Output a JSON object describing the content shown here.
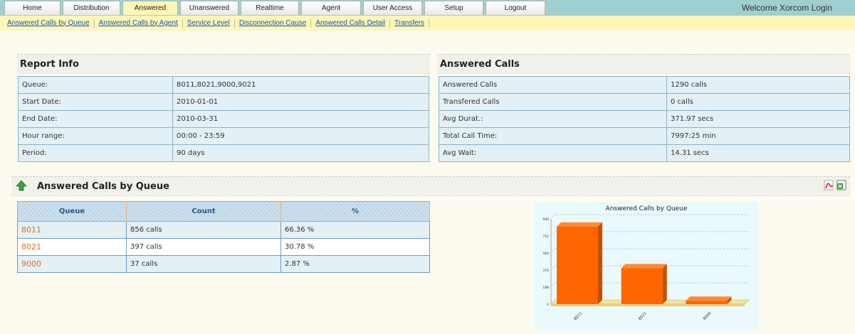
{
  "nav": {
    "tabs": [
      "Home",
      "Distribution",
      "Answered",
      "Unanswered",
      "Realtime",
      "Agent",
      "User Access",
      "Setup",
      "Logout"
    ],
    "active": "Answered",
    "welcome": "Welcome Xorcom Login"
  },
  "subnav": [
    "Answered Calls by Queue",
    "Answered Calls by Agent",
    "Service Level",
    "Disconnection Cause",
    "Answered Calls Detail",
    "Transfers"
  ],
  "report_info": {
    "title": "Report Info",
    "rows": [
      {
        "label": "Queue:",
        "value": "8011,8021,9000,9021"
      },
      {
        "label": "Start Date:",
        "value": "2010-01-01"
      },
      {
        "label": "End Date:",
        "value": "2010-03-31"
      },
      {
        "label": "Hour range:",
        "value": "00:00 - 23:59"
      },
      {
        "label": "Period:",
        "value": "90 days"
      }
    ]
  },
  "answered_calls": {
    "title": "Answered Calls",
    "rows": [
      {
        "label": "Answered Calls",
        "value": "1290 calls"
      },
      {
        "label": "Transfered Calls",
        "value": "0 calls"
      },
      {
        "label": "Avg Durat.:",
        "value": "371.97 secs"
      },
      {
        "label": "Total Call Time:",
        "value": "7997:25 min"
      },
      {
        "label": "Avg Wait:",
        "value": "14.31 secs"
      }
    ]
  },
  "by_queue": {
    "title": "Answered Calls by Queue",
    "headers": [
      "Queue",
      "Count",
      "%"
    ],
    "rows": [
      {
        "queue": "8011",
        "count": "856 calls",
        "pct": "66.36 %"
      },
      {
        "queue": "8021",
        "count": "397 calls",
        "pct": "30.78 %"
      },
      {
        "queue": "9000",
        "count": "37 calls",
        "pct": "2.87 %"
      }
    ],
    "icons": [
      "up-arrow-icon",
      "pdf-icon",
      "excel-icon"
    ]
  },
  "colors": {
    "bar": "#ff6600",
    "bar_dark": "#c74d00",
    "floor": "#f3e2a0",
    "topbar": "#9fcfcf",
    "subbar": "#fdf6b8"
  },
  "chart_data": {
    "type": "bar",
    "title": "Answered Calls by Queue",
    "categories": [
      "8011",
      "8021",
      "9000"
    ],
    "values": [
      856,
      397,
      37
    ],
    "yticks": [
      0,
      188,
      376,
      564,
      752,
      940
    ],
    "ylim": [
      0,
      940
    ],
    "xlabel": "",
    "ylabel": "",
    "grid": true
  }
}
